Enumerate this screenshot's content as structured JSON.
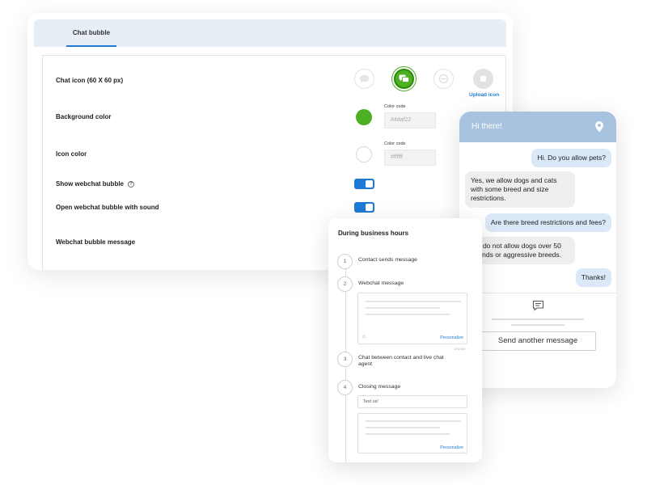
{
  "settings": {
    "tab_label": "Chat bubble",
    "rows": {
      "chat_icon": "Chat icon (60 X 60 px)",
      "background_color": "Background color",
      "icon_color": "Icon color",
      "show_bubble": "Show webchat bubble",
      "open_with_sound": "Open webchat bubble with sound",
      "bubble_message": "Webchat bubble message"
    },
    "upload_icon_label": "Upload icon",
    "color_code_caption": "Color code",
    "background_color_code": "#4daf22",
    "icon_color_code": "#ffffff",
    "show_bubble_on": true,
    "open_with_sound_on": true,
    "colors": {
      "accent": "#1f7ad6",
      "selected_icon": "#4daf22",
      "tab_bar": "#e8eef6"
    }
  },
  "chat": {
    "header_title": "Hi there!",
    "header_icon": "location-pin-icon",
    "messages": [
      {
        "from": "user",
        "text": "Hi. Do you allow pets?"
      },
      {
        "from": "agent",
        "text": "Yes, we allow dogs and cats with some breed and size restrictions."
      },
      {
        "from": "user",
        "text": "Are there breed restrictions and fees?"
      },
      {
        "from": "agent",
        "text": "We do not allow dogs over 50 pounds or aggressive breeds."
      },
      {
        "from": "user",
        "text": "Thanks!"
      }
    ],
    "footer_icon": "chat-message-icon",
    "send_button": "Send another message",
    "colors": {
      "header": "#a8c3e0",
      "user_bubble": "#dbe8f7",
      "agent_bubble": "#eeeeee"
    }
  },
  "hours": {
    "title": "During business hours",
    "steps": [
      {
        "num": "1",
        "label": "Contact sends message"
      },
      {
        "num": "2",
        "label": "Webchat message"
      },
      {
        "num": "3",
        "label": "Chat between contact and live chat agent"
      },
      {
        "num": "4",
        "label": "Closing message"
      }
    ],
    "personalize_label": "Personalize",
    "char_counter": "120/400",
    "closing_input_value": "Text us!"
  }
}
